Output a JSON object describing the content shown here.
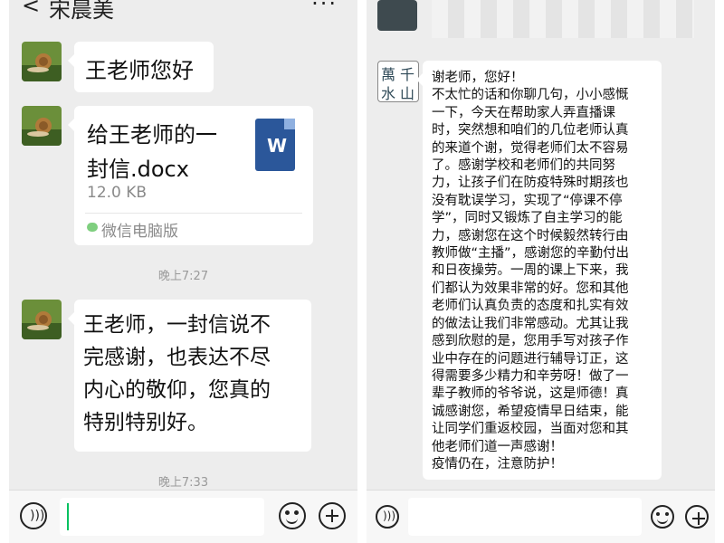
{
  "left": {
    "header": {
      "back_icon": "back-arrow-icon",
      "title": "宋晨美",
      "more": "···"
    },
    "messages": [
      {
        "type": "text",
        "text": "王老师您好"
      },
      {
        "type": "file",
        "file_name_line1": "给王老师的一",
        "file_name_line2": "封信.docx",
        "file_size": "12.0 KB",
        "source": "微信电脑版",
        "file_icon_letter": "W"
      },
      {
        "type": "time",
        "text": "晚上7:27"
      },
      {
        "type": "text",
        "lines": [
          "王老师，一封信说不",
          "完感谢，也表达不尽",
          "内心的敬仰，您真的",
          "特别特别好。"
        ]
      },
      {
        "type": "time",
        "text": "晚上7:33"
      }
    ]
  },
  "right": {
    "avatar_chars": [
      "萬",
      "千",
      "水",
      "山"
    ],
    "message_lines": [
      "谢老师，您好！",
      "不太忙的话和你聊几句，小小感慨",
      "一下，今天在帮助家人弄直播课",
      "时，突然想和咱们的几位老师认真",
      "的来道个谢，觉得老师们太不容易",
      "了。感谢学校和老师们的共同努",
      "力，让孩子们在防疫特殊时期孩也",
      "没有耽误学习，实现了“停课不停",
      "学”，同时又锻炼了自主学习的能",
      "力，感谢您在这个时候毅然转行由",
      "教师做“主播”，感谢您的辛勤付出",
      "和日夜操劳。一周的课上下来，我",
      "们都认为效果非常的好。您和其他",
      "老师们认真负责的态度和扎实有效",
      "的做法让我们非常感动。尤其让我",
      "感到欣慰的是，您用手写对孩子作",
      "业中存在的问题进行辅导订正，这",
      "得需要多少精力和辛劳呀！做了一",
      "辈子教师的爷爷说，这是师德！真",
      "诚感谢您，希望疫情早日结束，能",
      "让同学们重返校园，当面对您和其",
      "他老师们道一声感谢！",
      "疫情仍在，注意防护！"
    ]
  },
  "colors": {
    "wechat_green": "#07c160",
    "word_blue": "#2b579a",
    "bubble_bg": "#ffffff",
    "chat_bg": "#ededed"
  }
}
